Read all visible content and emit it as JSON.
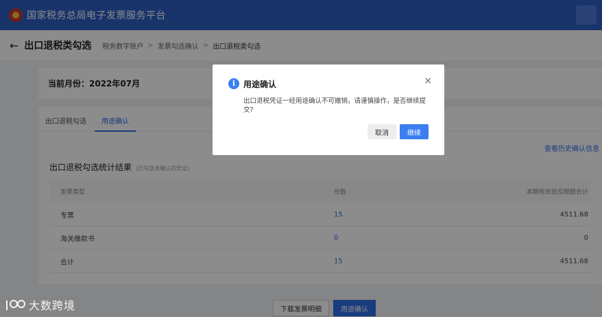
{
  "app": {
    "title": "国家税务总局电子发票服务平台",
    "logo": "tax-emblem-icon"
  },
  "header": {
    "back_icon": "←",
    "title": "出口退税类勾选",
    "breadcrumb": [
      "税务数字账户",
      "发票勾选确认",
      "出口退税类勾选"
    ],
    "separator": ">"
  },
  "month": {
    "label": "当前月份：2022年07月"
  },
  "tabs": [
    {
      "label": "出口退税勾选"
    },
    {
      "label": "用途确认",
      "active": true
    }
  ],
  "history_link": "查看历史确认信息",
  "section": {
    "title": "出口退税勾选统计结果",
    "subtitle": "(已勾选未确认的凭证)"
  },
  "table": {
    "headers": [
      "发票类型",
      "份数",
      "本期有效抵扣税额合计"
    ],
    "rows": [
      [
        "专票",
        "15",
        "4511.68"
      ],
      [
        "海关缴款书",
        "0",
        "0"
      ],
      [
        "合计",
        "15",
        "4511.68"
      ]
    ]
  },
  "actions": {
    "download": "下载发票明细",
    "confirm": "用途确认"
  },
  "modal": {
    "title": "用途确认",
    "message": "出口退税凭证一经用途确认不可撤销，请谨慎操作，是否继续提交?",
    "cancel": "取消",
    "continue": "继续",
    "close_icon": "×",
    "info_icon": "i"
  },
  "watermark": {
    "text": "大数跨境"
  },
  "colors": {
    "primary": "#2e6ee6",
    "appbar": "#2e5fc4",
    "link": "#2e6ee6"
  }
}
